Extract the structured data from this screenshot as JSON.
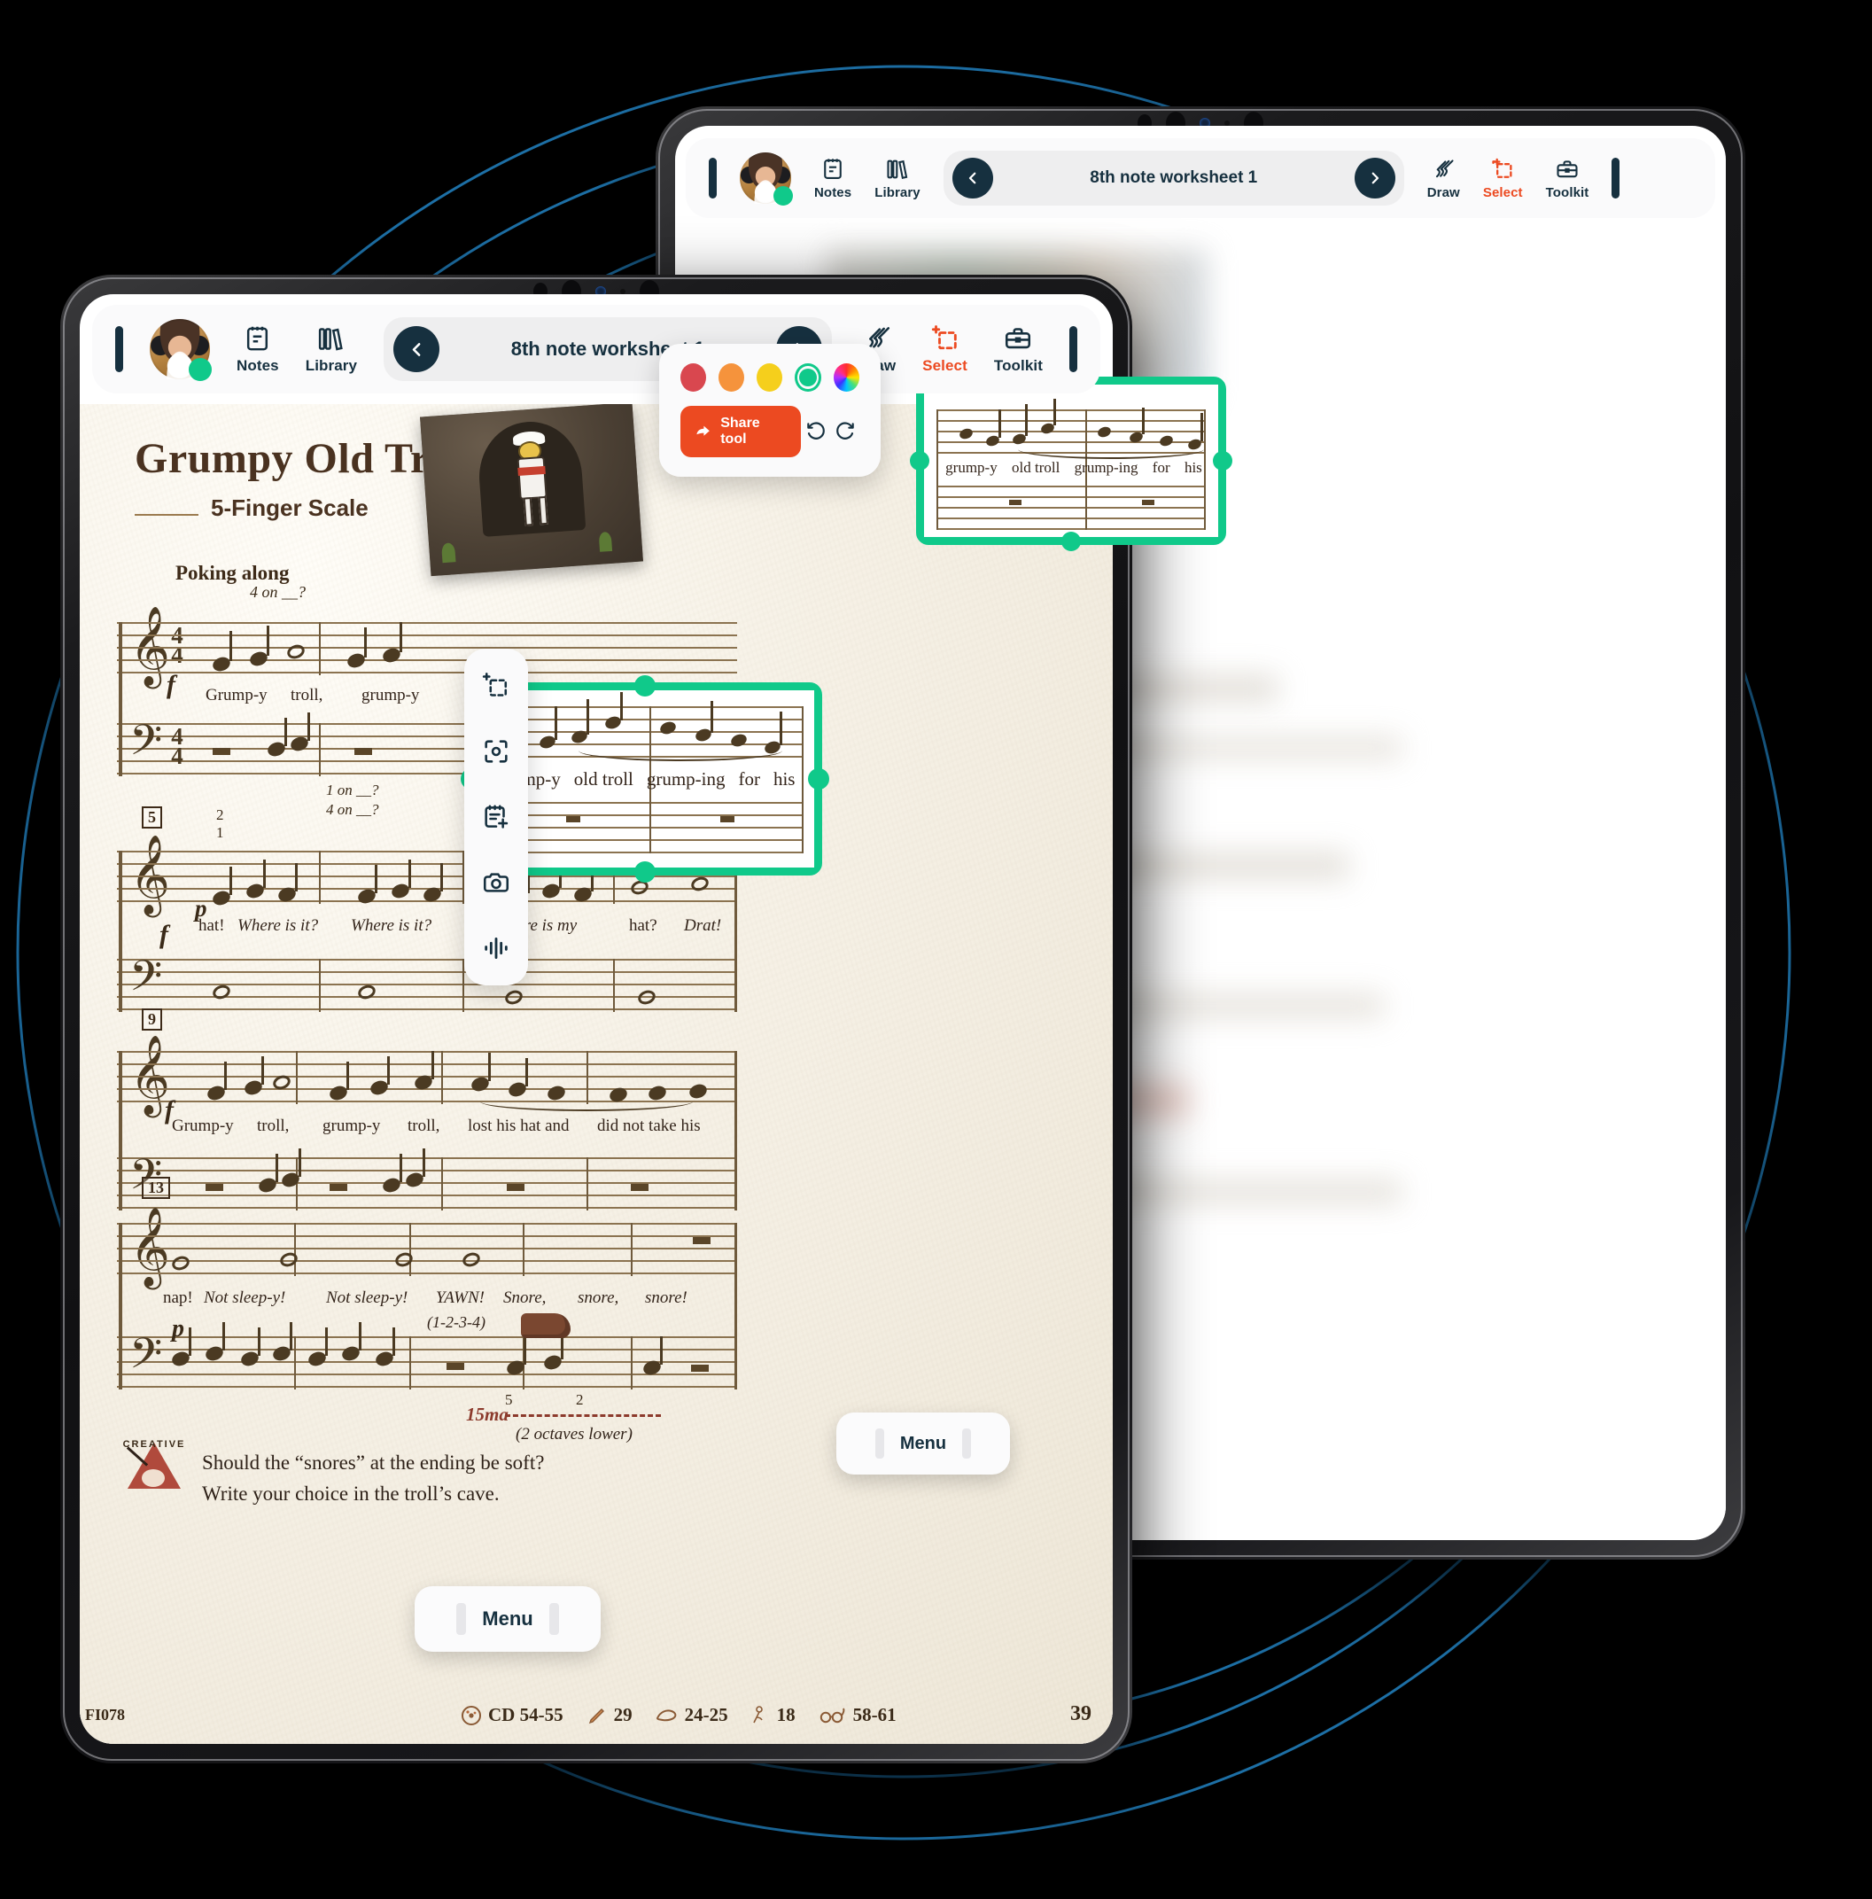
{
  "app": {
    "brand_colors": {
      "ink": "#16303f",
      "accent_green": "#10c98a",
      "accent_orange": "#ec4a21",
      "toolbar_bg": "#fafafb",
      "pill_bg": "#eeeeef"
    },
    "toolbar": {
      "avatar_name": "student-avatar",
      "status": "online",
      "items": [
        {
          "icon": "notes-icon",
          "label": "Notes",
          "active": false
        },
        {
          "icon": "library-icon",
          "label": "Library",
          "active": false
        }
      ],
      "title": "8th note worksheet 1",
      "prev_label": "‹",
      "next_label": "›",
      "right_items": [
        {
          "icon": "draw-icon",
          "label": "Draw",
          "active": false
        },
        {
          "icon": "select-icon",
          "label": "Select",
          "active": true
        },
        {
          "icon": "toolkit-icon",
          "label": "Toolkit",
          "active": false
        }
      ]
    },
    "color_popover": {
      "swatches": [
        {
          "name": "red",
          "hex": "#d9474f",
          "selected": false
        },
        {
          "name": "orange",
          "hex": "#f5933c",
          "selected": false
        },
        {
          "name": "yellow",
          "hex": "#f5cf1c",
          "selected": false
        },
        {
          "name": "green",
          "hex": "#10c98a",
          "selected": true
        },
        {
          "name": "color-wheel",
          "hex": "rainbow",
          "selected": false
        }
      ],
      "share_label": "Share tool",
      "undo_label": "undo-icon",
      "redo_label": "redo-icon"
    },
    "vertical_tools": [
      "select-region-icon",
      "focus-point-icon",
      "add-note-icon",
      "camera-icon",
      "audio-waveform-icon"
    ],
    "menu_pill_label": "Menu"
  },
  "worksheet": {
    "title": "Grumpy Old Troll",
    "subtitle": "5-Finger Scale",
    "tempo": "Poking along",
    "page_number": "39",
    "catalog_code": "FI078",
    "selection_lyrics": [
      "grump-y",
      "old troll",
      "grump-ing",
      "for",
      "his"
    ],
    "footer_meta": [
      {
        "icon": "cd-icon",
        "value": "CD 54-55"
      },
      {
        "icon": "pencil-icon",
        "value": "29"
      },
      {
        "icon": "hand-icon",
        "value": "24-25"
      },
      {
        "icon": "flower-icon",
        "value": "18"
      },
      {
        "icon": "glasses-icon",
        "value": "58-61"
      }
    ],
    "creative": {
      "badge": "CREATIVE",
      "line1": "Should the “snores” at the ending be soft?",
      "line2": "Write your choice in the troll’s cave."
    },
    "systems": [
      {
        "number": "",
        "time_signature": "4/4",
        "fingering": [
          "4 on __?"
        ],
        "lyrics": [
          "Grump-y",
          "troll,",
          "grump-y"
        ],
        "dynamic": "f"
      },
      {
        "number": "5",
        "fingering": [
          "2",
          "1",
          "1 on __?",
          "4 on __?"
        ],
        "lyrics": [
          "hat!",
          "Where is it?",
          "Where is it?",
          "Where is my",
          "hat?",
          "Drat!"
        ],
        "dynamic": "p"
      },
      {
        "number": "9",
        "lyrics": [
          "Grump-y",
          "troll,",
          "grump-y",
          "troll,",
          "lost his hat and",
          "did not take his"
        ],
        "dynamic": "f"
      },
      {
        "number": "13",
        "lyrics": [
          "nap!",
          "Not sleep-y!",
          "Not sleep-y!",
          "YAWN!",
          "(1-2-3-4)",
          "Snore,",
          "snore,",
          "snore!"
        ],
        "dynamic": "p",
        "ottava": "15ma",
        "ottava_note": "(2 octaves lower)",
        "fingering": [
          "5",
          "2"
        ]
      }
    ]
  }
}
